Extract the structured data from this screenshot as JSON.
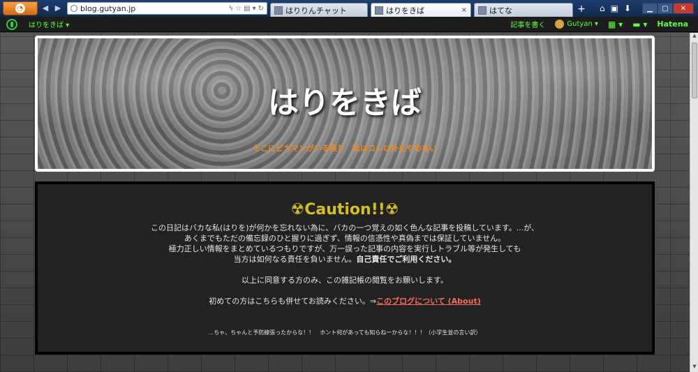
{
  "browser": {
    "url": "blog.gutyan.jp",
    "tabs": [
      {
        "label": "はりりんチャット",
        "active": false
      },
      {
        "label": "はりをきば",
        "active": true
      },
      {
        "label": "はてな",
        "active": false
      }
    ],
    "new_tab": "+",
    "close_tab": "×"
  },
  "hatenabar": {
    "blog_name": "はりをきば ▾",
    "write_post": "記事を書く",
    "user": "Gutyan ▾",
    "apps": "▦ ▾",
    "notify": "▬ ▾",
    "hatena": "Hatena"
  },
  "header": {
    "title": "はりをきば",
    "tagline": "そこにピカマンがいる限り　私はコレ以外をやめない"
  },
  "caution": {
    "title": "☢Caution!!☢",
    "lines": [
      "この日記はバカな私(はりを)が何かを忘れない為に、バカの一つ覚えの如く色んな記事を投稿しています。...が、",
      "あくまでもただの備忘録のひと握りに過ぎず、情報の信憑性や真偽までは保証していません。",
      "極力正しい情報をまとめているつもりですが、万一誤った記事の内容を実行しトラブル等が発生しても"
    ],
    "line4_pre": "当方は如何なる責任を負いません。",
    "line4_strong": "自己責任でご利用ください。",
    "agree": "以上に同意する方のみ、この雑記帳の閲覧をお願いします。",
    "first_pre": "初めての方はこちらも併せてお読みください。⇒",
    "first_link": "このブログについて (About)",
    "joke": "...ちゃ、ちゃんと予防線張ったからな！！　ホント何があっても知らねーからな！！！（小学生並の言い訳）"
  }
}
